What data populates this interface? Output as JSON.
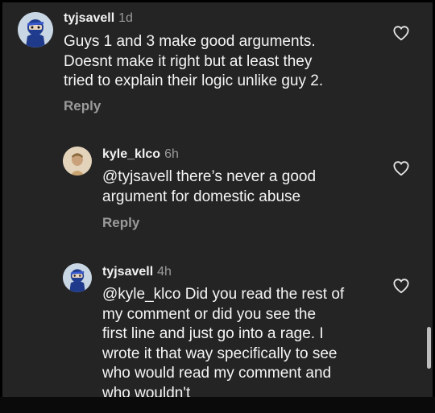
{
  "comments": [
    {
      "username": "tyjsavell",
      "time": "1d",
      "text_lines": [
        "Guys 1 and 3 make good arguments.",
        "Doesnt make it right but at least they",
        "tried to explain their logic unlike guy 2."
      ],
      "reply_label": "Reply",
      "avatar_icon": "ninja-avatar-icon"
    },
    {
      "username": "kyle_klco",
      "time": "6h",
      "mention": "@tyjsavell",
      "text_lines": [
        " there’s never a good",
        "argument for domestic abuse"
      ],
      "reply_label": "Reply",
      "avatar_icon": "profile-photo-icon"
    },
    {
      "username": "tyjsavell",
      "time": "4h",
      "mention": "@kyle_klco",
      "text_lines": [
        " Did you read the rest of",
        "my comment or did you see the",
        "first line and just go into a rage. I",
        "wrote it that way specifically to see",
        "who would read my comment and",
        "who wouldn't"
      ],
      "avatar_icon": "ninja-avatar-icon"
    }
  ],
  "icons": {
    "like": "heart-outline-icon"
  },
  "colors": {
    "background": "#242424",
    "text": "#f5f5f5",
    "muted": "#9b9b9b"
  }
}
